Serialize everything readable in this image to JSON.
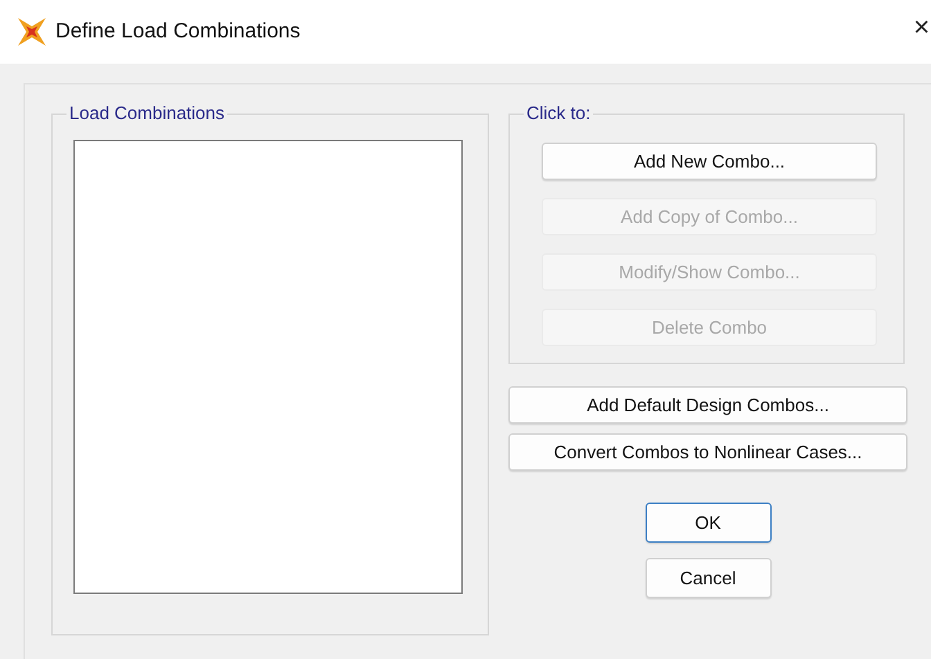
{
  "window": {
    "title": "Define Load Combinations",
    "close": "×"
  },
  "load_combinations": {
    "label": "Load Combinations"
  },
  "click_to": {
    "label": "Click to:",
    "buttons": [
      {
        "label": "Add New Combo...",
        "disabled": false
      },
      {
        "label": "Add Copy of Combo...",
        "disabled": true
      },
      {
        "label": "Modify/Show Combo...",
        "disabled": true
      },
      {
        "label": "Delete Combo",
        "disabled": true
      }
    ]
  },
  "actions": [
    {
      "label": "Add Default Design Combos...",
      "disabled": false
    },
    {
      "label": "Convert Combos to Nonlinear Cases...",
      "disabled": false
    }
  ],
  "dialog_buttons": [
    {
      "label": "OK",
      "default": true
    },
    {
      "label": "Cancel",
      "default": false
    }
  ]
}
